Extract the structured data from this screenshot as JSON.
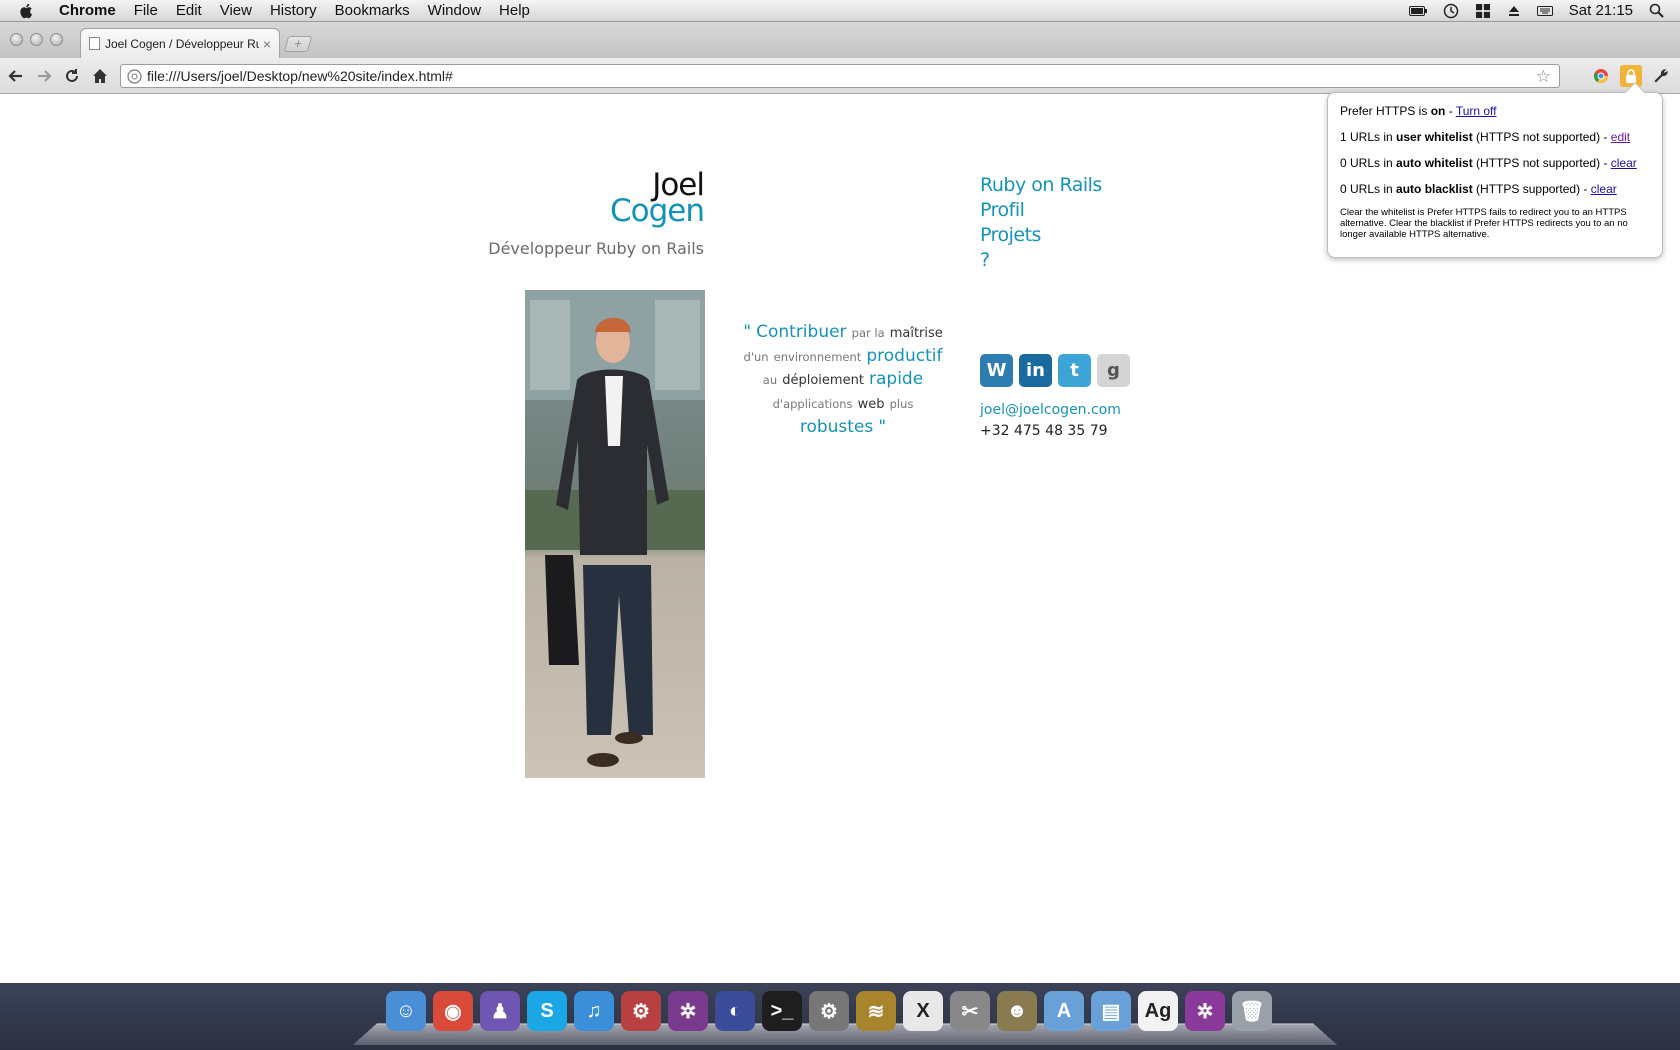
{
  "menubar": {
    "app": "Chrome",
    "items": [
      "File",
      "Edit",
      "View",
      "History",
      "Bookmarks",
      "Window",
      "Help"
    ],
    "clock": "Sat 21:15"
  },
  "tab": {
    "title": "Joel Cogen / Développeur Ru",
    "close": "×",
    "new_tab": "+"
  },
  "omnibox": {
    "url": "file:///Users/joel/Desktop/new%20site/index.html#"
  },
  "popup": {
    "line1": {
      "prefix": "Prefer HTTPS is ",
      "bold": "on",
      "suffix": " - ",
      "link": "Turn off"
    },
    "line2": {
      "prefix": "1 URLs in ",
      "bold": "user whitelist",
      "suffix": " (HTTPS not supported) - ",
      "link": "edit"
    },
    "line3": {
      "prefix": "0 URLs in ",
      "bold": "auto whitelist",
      "suffix": " (HTTPS not supported) - ",
      "link": "clear"
    },
    "line4": {
      "prefix": "0 URLs in ",
      "bold": "auto blacklist",
      "suffix": " (HTTPS supported) - ",
      "link": "clear"
    },
    "note": "Clear the whitelist is Prefer HTTPS fails to redirect you to an HTTPS alternative. Clear the blacklist if Prefer HTTPS redirects you to an no longer available HTTPS alternative."
  },
  "page": {
    "first_name": "Joel",
    "last_name": "Cogen",
    "subtitle": "Développeur Ruby on Rails",
    "nav": [
      "Ruby on Rails",
      "Profil",
      "Projets",
      "?"
    ],
    "quote": {
      "open": "\"",
      "w1": "Contribuer",
      "w2": "par la",
      "w3": "maîtrise",
      "w4": "d'un",
      "w5": "environnement",
      "w6": "productif",
      "w7": "au",
      "w8": "déploiement",
      "w9": "rapide",
      "w10": "d'applications",
      "w11": "web",
      "w12": "plus",
      "w13": "robustes",
      "close": "\""
    },
    "social": [
      {
        "icon": "wordpress-icon",
        "glyph": "W",
        "color": "#2e7db0"
      },
      {
        "icon": "linkedin-icon",
        "glyph": "in",
        "color": "#1a6aa0"
      },
      {
        "icon": "twitter-icon",
        "glyph": "t",
        "color": "#3da5d6"
      },
      {
        "icon": "google-icon",
        "glyph": "g",
        "color": "#d4d4d4"
      }
    ],
    "email": "joel@joelcogen.com",
    "phone": "+32 475 48 35 79"
  },
  "dock": {
    "apps": [
      {
        "icon": "finder-icon",
        "glyph": "☺",
        "color": "#4a8fd6"
      },
      {
        "icon": "chrome-icon",
        "glyph": "◉",
        "color": "#d94a3a"
      },
      {
        "icon": "adium-icon",
        "glyph": "♟",
        "color": "#6f56b3"
      },
      {
        "icon": "skype-icon",
        "glyph": "S",
        "color": "#1ba7e5"
      },
      {
        "icon": "itunes-icon",
        "glyph": "♫",
        "color": "#3a8fd8"
      },
      {
        "icon": "transmission-icon",
        "glyph": "⚙",
        "color": "#b94040"
      },
      {
        "icon": "project-icon",
        "glyph": "✲",
        "color": "#7a3b8f"
      },
      {
        "icon": "eclipse-icon",
        "glyph": "◐",
        "color": "#3b4c9a"
      },
      {
        "icon": "terminal-icon",
        "glyph": ">_",
        "color": "#1e1e1e"
      },
      {
        "icon": "system-preferences-icon",
        "glyph": "⚙",
        "color": "#777"
      },
      {
        "icon": "wifi-icon",
        "glyph": "≋",
        "color": "#a8842c"
      },
      {
        "icon": "x11-icon",
        "glyph": "X",
        "color": "#e8e8e8"
      },
      {
        "icon": "scissors-icon",
        "glyph": "✂",
        "color": "#888"
      },
      {
        "icon": "gimp-icon",
        "glyph": "☻",
        "color": "#8a7a50"
      },
      {
        "icon": "applications-folder-icon",
        "glyph": "A",
        "color": "#6aa0d8"
      },
      {
        "icon": "documents-folder-icon",
        "glyph": "▤",
        "color": "#6aa0d8"
      },
      {
        "icon": "font-book-icon",
        "glyph": "Ag",
        "color": "#f2f2f2"
      },
      {
        "icon": "project-file-icon",
        "glyph": "✲",
        "color": "#8a3a9a"
      },
      {
        "icon": "trash-icon",
        "glyph": "🗑",
        "color": "#9aa0a8"
      }
    ]
  }
}
